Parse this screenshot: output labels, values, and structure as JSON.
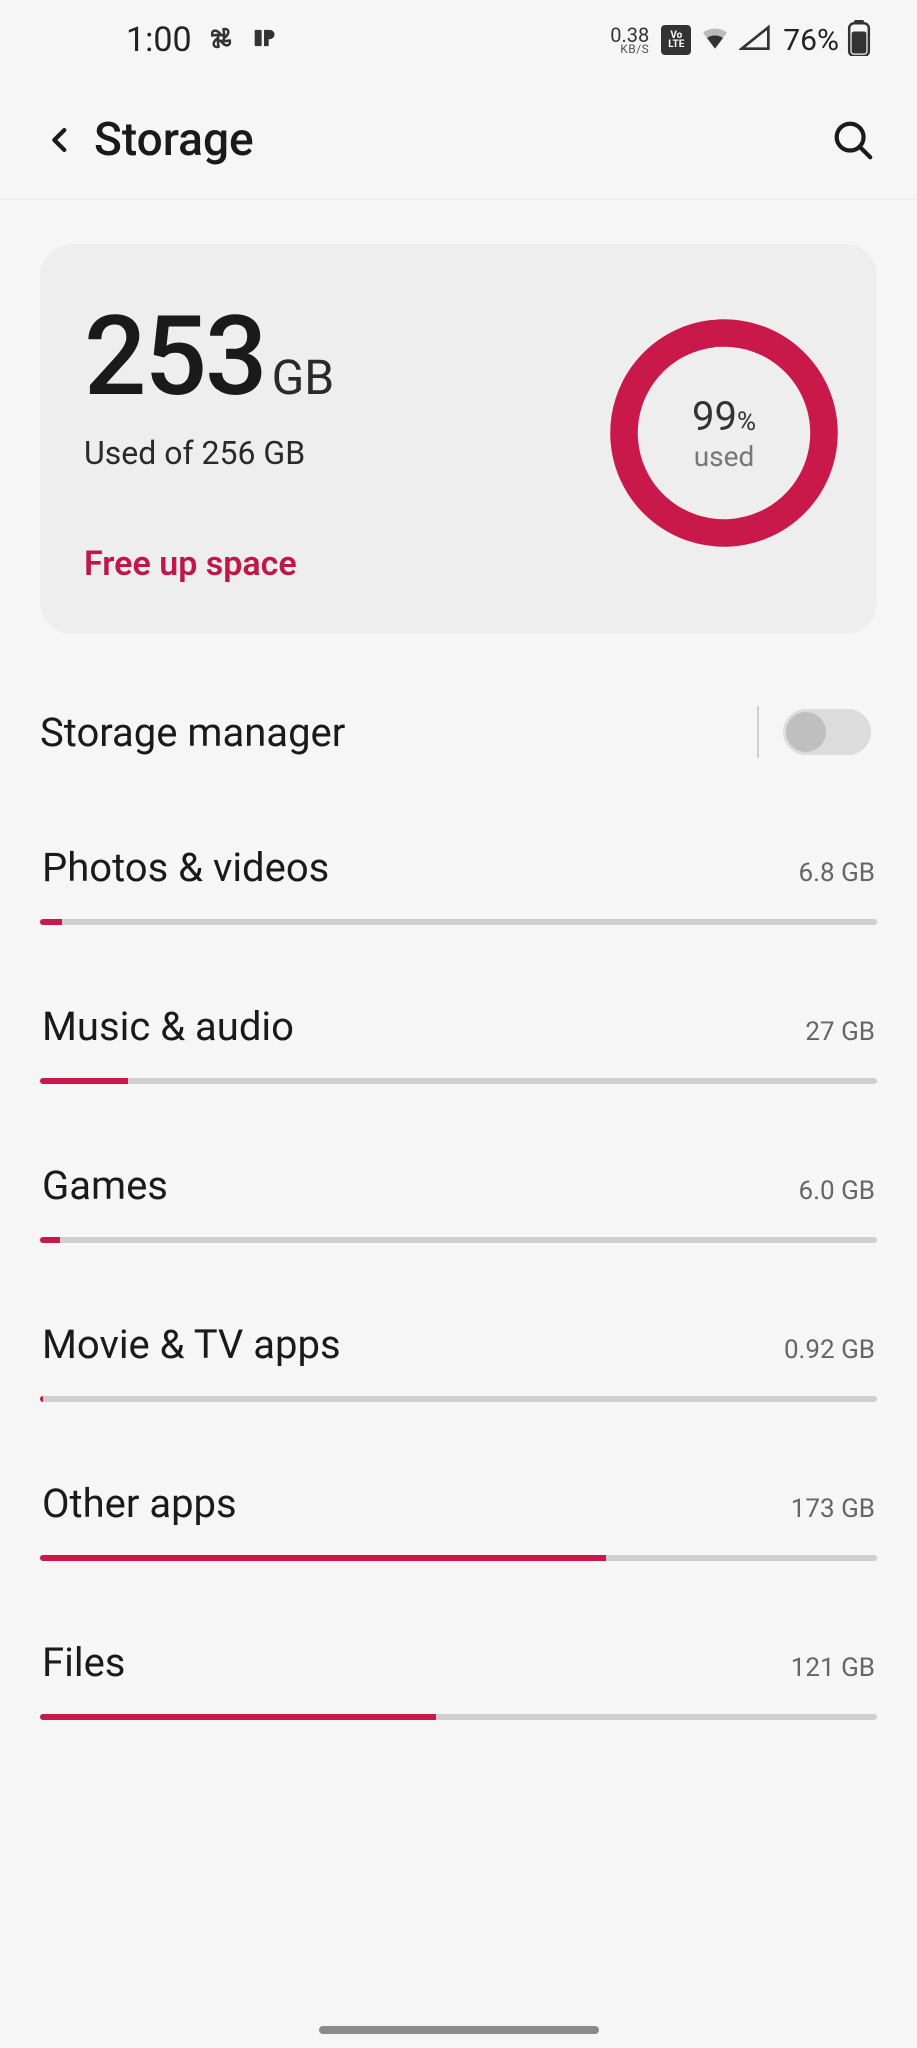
{
  "statusbar": {
    "time": "1:00",
    "net_speed_value": "0.38",
    "net_speed_unit": "KB/S",
    "volte": "VoLTE",
    "battery_text": "76%"
  },
  "appbar": {
    "title": "Storage"
  },
  "summary": {
    "used_value": "253",
    "used_unit": "GB",
    "used_caption": "Used of 256 GB",
    "free_up_label": "Free up space",
    "donut_percent": "99",
    "donut_percent_symbol": "%",
    "donut_label": "used",
    "donut_fill_percent": 99
  },
  "storage_manager": {
    "label": "Storage manager",
    "enabled": false
  },
  "total_gb": 256,
  "categories": [
    {
      "name": "Photos & videos",
      "size": "6.8 GB",
      "gb": 6.8
    },
    {
      "name": "Music & audio",
      "size": "27 GB",
      "gb": 27
    },
    {
      "name": "Games",
      "size": "6.0 GB",
      "gb": 6.0
    },
    {
      "name": "Movie & TV apps",
      "size": "0.92 GB",
      "gb": 0.92
    },
    {
      "name": "Other apps",
      "size": "173 GB",
      "gb": 173
    },
    {
      "name": "Files",
      "size": "121 GB",
      "gb": 121
    }
  ]
}
